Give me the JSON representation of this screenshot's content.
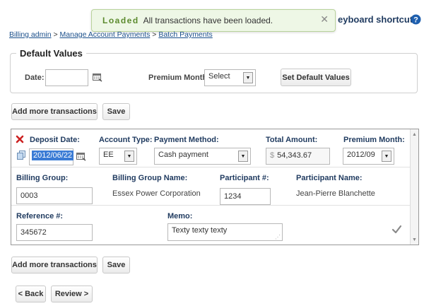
{
  "toast": {
    "title": "Loaded",
    "message": "All transactions have been loaded."
  },
  "header": {
    "shortcuts_label": "eyboard shortcuts"
  },
  "breadcrumb": {
    "items": [
      "Billing admin",
      "Manage Account Payments",
      "Batch Payments"
    ],
    "separator": ">"
  },
  "default_values": {
    "legend": "Default Values",
    "date_label": "Date:",
    "date_value": "",
    "premium_month_label": "Premium Month:",
    "premium_month_value": "Select",
    "set_button": "Set Default Values"
  },
  "actions_top": {
    "add_label": "Add more transactions",
    "save_label": "Save"
  },
  "transaction": {
    "deposit_date_label": "Deposit Date:",
    "deposit_date_value": "2012/06/22",
    "account_type_label": "Account Type:",
    "account_type_value": "EE",
    "payment_method_label": "Payment Method:",
    "payment_method_value": "Cash payment",
    "total_amount_label": "Total Amount:",
    "currency_symbol": "$",
    "total_amount_value": "54,343.67",
    "premium_month_label": "Premium Month:",
    "premium_month_value": "2012/09",
    "billing_group_label": "Billing Group:",
    "billing_group_value": "0003",
    "billing_group_name_label": "Billing Group Name:",
    "billing_group_name_value": "Essex Power Corporation",
    "participant_no_label": "Participant #:",
    "participant_no_value": "1234",
    "participant_name_label": "Participant Name:",
    "participant_name_value": "Jean-Pierre Blanchette",
    "reference_label": "Reference #:",
    "reference_value": "345672",
    "memo_label": "Memo:",
    "memo_value": "Texty texty texty"
  },
  "actions_bottom": {
    "add_label": "Add more transactions",
    "save_label": "Save"
  },
  "nav": {
    "back_label": "< Back",
    "review_label": "Review >"
  },
  "icons": {
    "remove": "close-x-icon",
    "copy": "copy-icon",
    "calendar": "calendar-icon",
    "help": "help-icon",
    "valid": "checkmark-icon"
  },
  "colors": {
    "link": "#1a4f8b",
    "remove": "#cc2222",
    "help": "#1e5fae",
    "toast_bg": "#eef7e6",
    "toast_title": "#5b8a2d"
  }
}
